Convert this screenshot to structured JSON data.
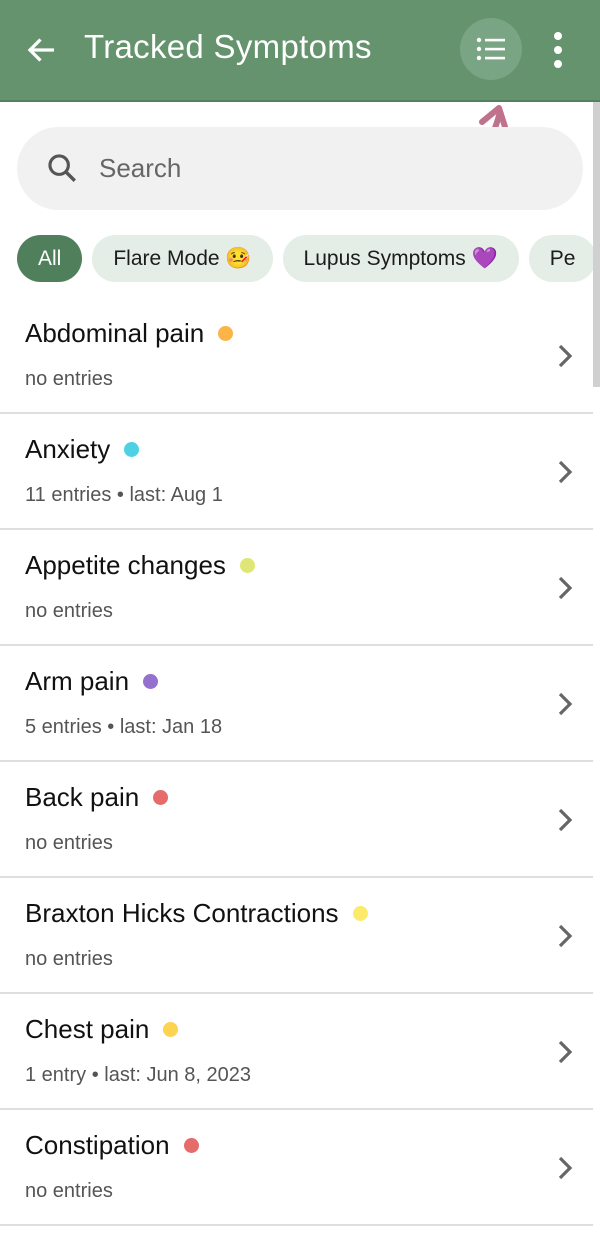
{
  "appbar": {
    "title": "Tracked Symptoms",
    "back_icon": "arrow-left-icon",
    "list_icon": "list-view-icon",
    "more_icon": "more-vert-icon",
    "arrow_color": "#c0728c"
  },
  "search": {
    "placeholder": "Search"
  },
  "chips": [
    {
      "label": "All",
      "active": true
    },
    {
      "label": "Flare Mode 🤒"
    },
    {
      "label": "Lupus Symptoms 💜"
    },
    {
      "label": "Pe"
    }
  ],
  "symptoms": [
    {
      "name": "Abdominal pain",
      "color": "#fbb447",
      "sub": "no entries"
    },
    {
      "name": "Anxiety",
      "color": "#4fd1e4",
      "sub": "11 entries • last: Aug 1"
    },
    {
      "name": "Appetite changes",
      "color": "#dfe675",
      "sub": "no entries"
    },
    {
      "name": "Arm pain",
      "color": "#9670cf",
      "sub": "5 entries • last: Jan 18"
    },
    {
      "name": "Back pain",
      "color": "#e66b6b",
      "sub": "no entries"
    },
    {
      "name": "Braxton Hicks Contractions",
      "color": "#fceb6b",
      "sub": "no entries"
    },
    {
      "name": "Chest pain",
      "color": "#fdd34f",
      "sub": "1 entry • last: Jun 8, 2023"
    },
    {
      "name": "Constipation",
      "color": "#e66b6b",
      "sub": "no entries"
    }
  ]
}
